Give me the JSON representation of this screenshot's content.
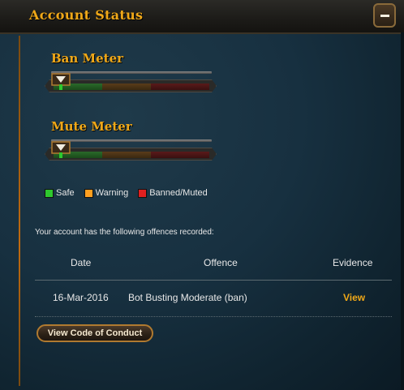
{
  "header": {
    "title": "Account Status",
    "collapse_icon": "minus-icon"
  },
  "meters": [
    {
      "label": "Ban Meter",
      "level": 0
    },
    {
      "label": "Mute Meter",
      "level": 0
    }
  ],
  "legend": [
    {
      "label": "Safe",
      "color": "#2ec82e"
    },
    {
      "label": "Warning",
      "color": "#ffa020"
    },
    {
      "label": "Banned/Muted",
      "color": "#e02020"
    }
  ],
  "offences": {
    "intro": "Your account has the following offences recorded:",
    "columns": [
      "Date",
      "Offence",
      "Evidence"
    ],
    "rows": [
      {
        "date": "16-Mar-2016",
        "offence": "Bot Busting Moderate (ban)",
        "evidence": "View"
      }
    ]
  },
  "actions": {
    "code_of_conduct": "View Code of Conduct"
  },
  "colors": {
    "accent": "#f0a818",
    "text": "#e8e8e8"
  }
}
